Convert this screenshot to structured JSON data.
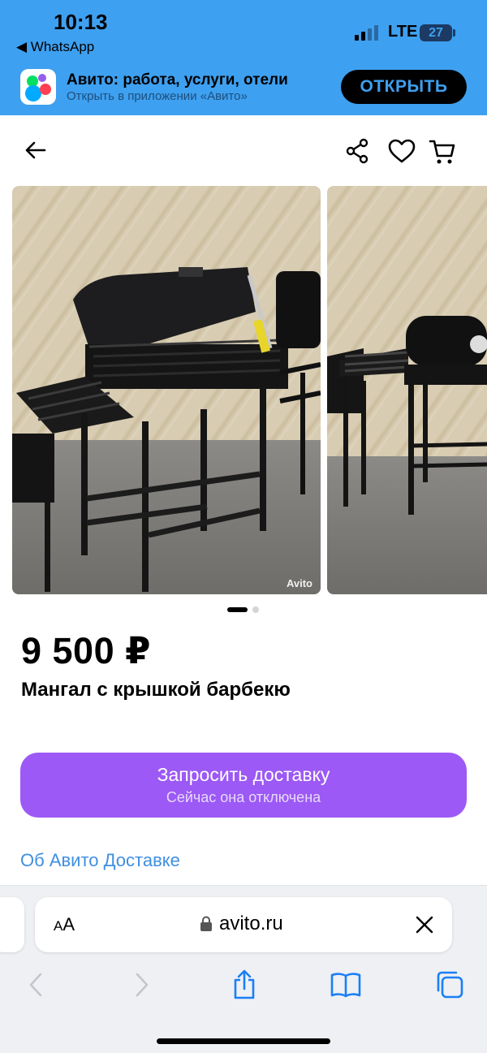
{
  "status_bar": {
    "time": "10:13",
    "back_app": "◀ WhatsApp",
    "network": "LTE",
    "battery": "27"
  },
  "app_banner": {
    "title": "Авито: работа, услуги, отели",
    "subtitle": "Открыть в приложении «Авито»",
    "open_button": "ОТКРЫТЬ"
  },
  "navigation": {
    "back_icon": "arrow-left-icon",
    "share_icon": "share-icon",
    "favorite_icon": "heart-icon",
    "cart_icon": "cart-icon"
  },
  "gallery": {
    "watermark": "Avito",
    "current_page": 1,
    "total_pages": 2
  },
  "listing": {
    "price": "9 500 ₽",
    "title": "Мангал с крышкой барбекю"
  },
  "delivery": {
    "button_label": "Запросить доставку",
    "button_sublabel": "Сейчас она отключена",
    "info_link": "Об Авито Доставке"
  },
  "browser": {
    "text_size_label": "AA",
    "url": "avito.ru"
  },
  "colors": {
    "accent_blue": "#3ea0f0",
    "delivery_purple": "#9c59f5",
    "link_blue": "#3f8fe2"
  }
}
